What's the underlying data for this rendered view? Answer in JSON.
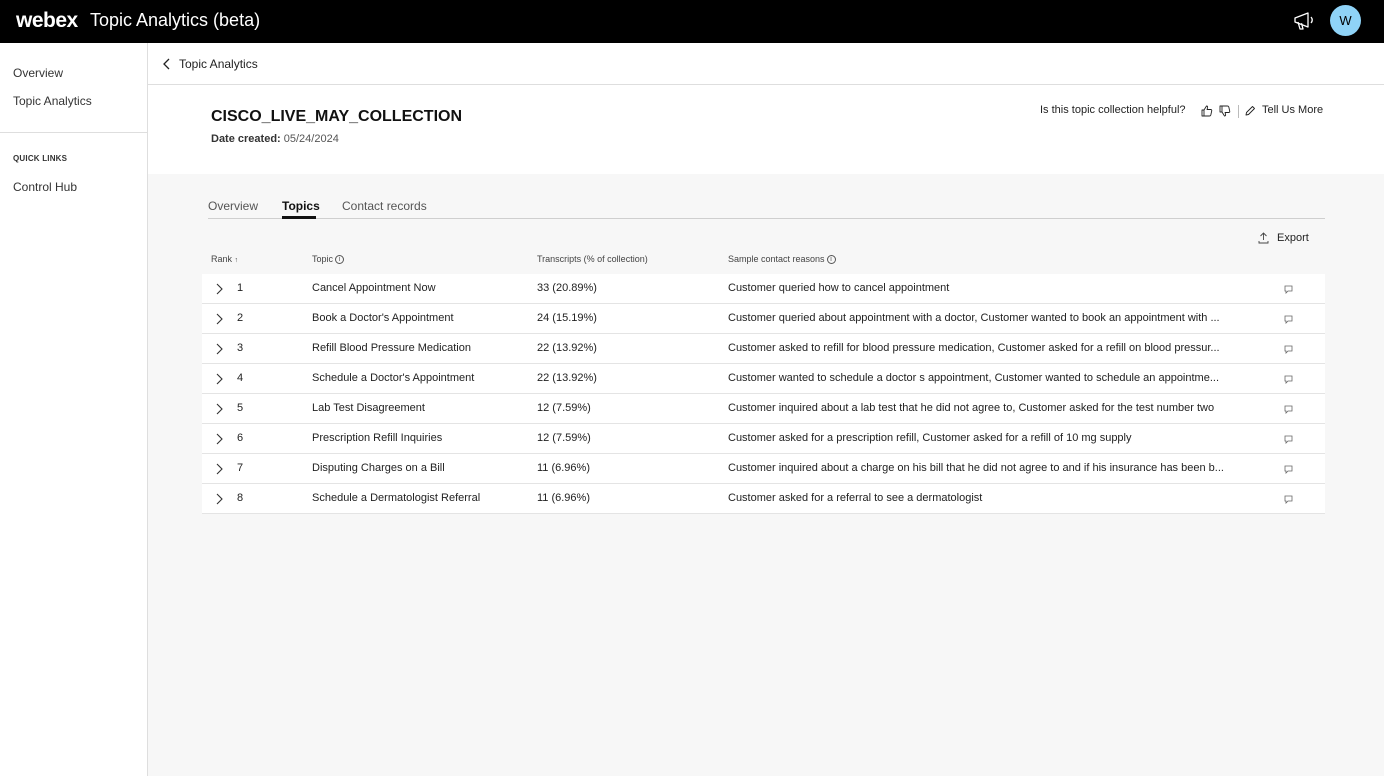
{
  "topbar": {
    "brand": "webex",
    "app_title": "Topic Analytics (beta)",
    "avatar_initial": "W"
  },
  "sidebar": {
    "items": [
      {
        "label": "Overview"
      },
      {
        "label": "Topic Analytics"
      }
    ],
    "quick_links_heading": "QUICK LINKS",
    "quick_links": [
      {
        "label": "Control Hub"
      }
    ]
  },
  "breadcrumb": {
    "back_label": "Topic Analytics"
  },
  "collection": {
    "title": "CISCO_LIVE_MAY_COLLECTION",
    "date_label": "Date created:",
    "date_value": "05/24/2024"
  },
  "feedback": {
    "question": "Is this topic collection helpful?",
    "tell_more": "Tell Us More"
  },
  "tabs": [
    {
      "label": "Overview",
      "active": false
    },
    {
      "label": "Topics",
      "active": true
    },
    {
      "label": "Contact records",
      "active": false
    }
  ],
  "export_label": "Export",
  "table": {
    "headers": {
      "rank": "Rank",
      "rank_sort": "↑",
      "topic": "Topic",
      "transcripts": "Transcripts (% of collection)",
      "reasons": "Sample contact reasons"
    },
    "rows": [
      {
        "rank": "1",
        "topic": "Cancel Appointment Now",
        "transcripts": "33 (20.89%)",
        "reason": "Customer queried how to cancel appointment"
      },
      {
        "rank": "2",
        "topic": "Book a Doctor's Appointment",
        "transcripts": "24 (15.19%)",
        "reason": "Customer queried about appointment with a doctor, Customer wanted to book an appointment with ..."
      },
      {
        "rank": "3",
        "topic": "Refill Blood Pressure Medication",
        "transcripts": "22 (13.92%)",
        "reason": "Customer asked to refill for blood pressure medication, Customer asked for a refill on blood pressur..."
      },
      {
        "rank": "4",
        "topic": "Schedule a Doctor's Appointment",
        "transcripts": "22 (13.92%)",
        "reason": "Customer wanted to schedule a doctor s appointment, Customer wanted to schedule an appointme..."
      },
      {
        "rank": "5",
        "topic": "Lab Test Disagreement",
        "transcripts": "12 (7.59%)",
        "reason": "Customer inquired about a lab test that he did not agree to, Customer asked for the test number two"
      },
      {
        "rank": "6",
        "topic": "Prescription Refill Inquiries",
        "transcripts": "12 (7.59%)",
        "reason": "Customer asked for a prescription refill, Customer asked for a refill of 10 mg supply"
      },
      {
        "rank": "7",
        "topic": "Disputing Charges on a Bill",
        "transcripts": "11 (6.96%)",
        "reason": "Customer inquired about a charge on his bill that he did not agree to and if his insurance has been b..."
      },
      {
        "rank": "8",
        "topic": "Schedule a Dermatologist Referral",
        "transcripts": "11 (6.96%)",
        "reason": "Customer asked for a referral to see a dermatologist"
      }
    ]
  },
  "colors": {
    "topbar": "#000000",
    "avatar": "#8fd3f7",
    "page_bg": "#f7f7f7"
  }
}
